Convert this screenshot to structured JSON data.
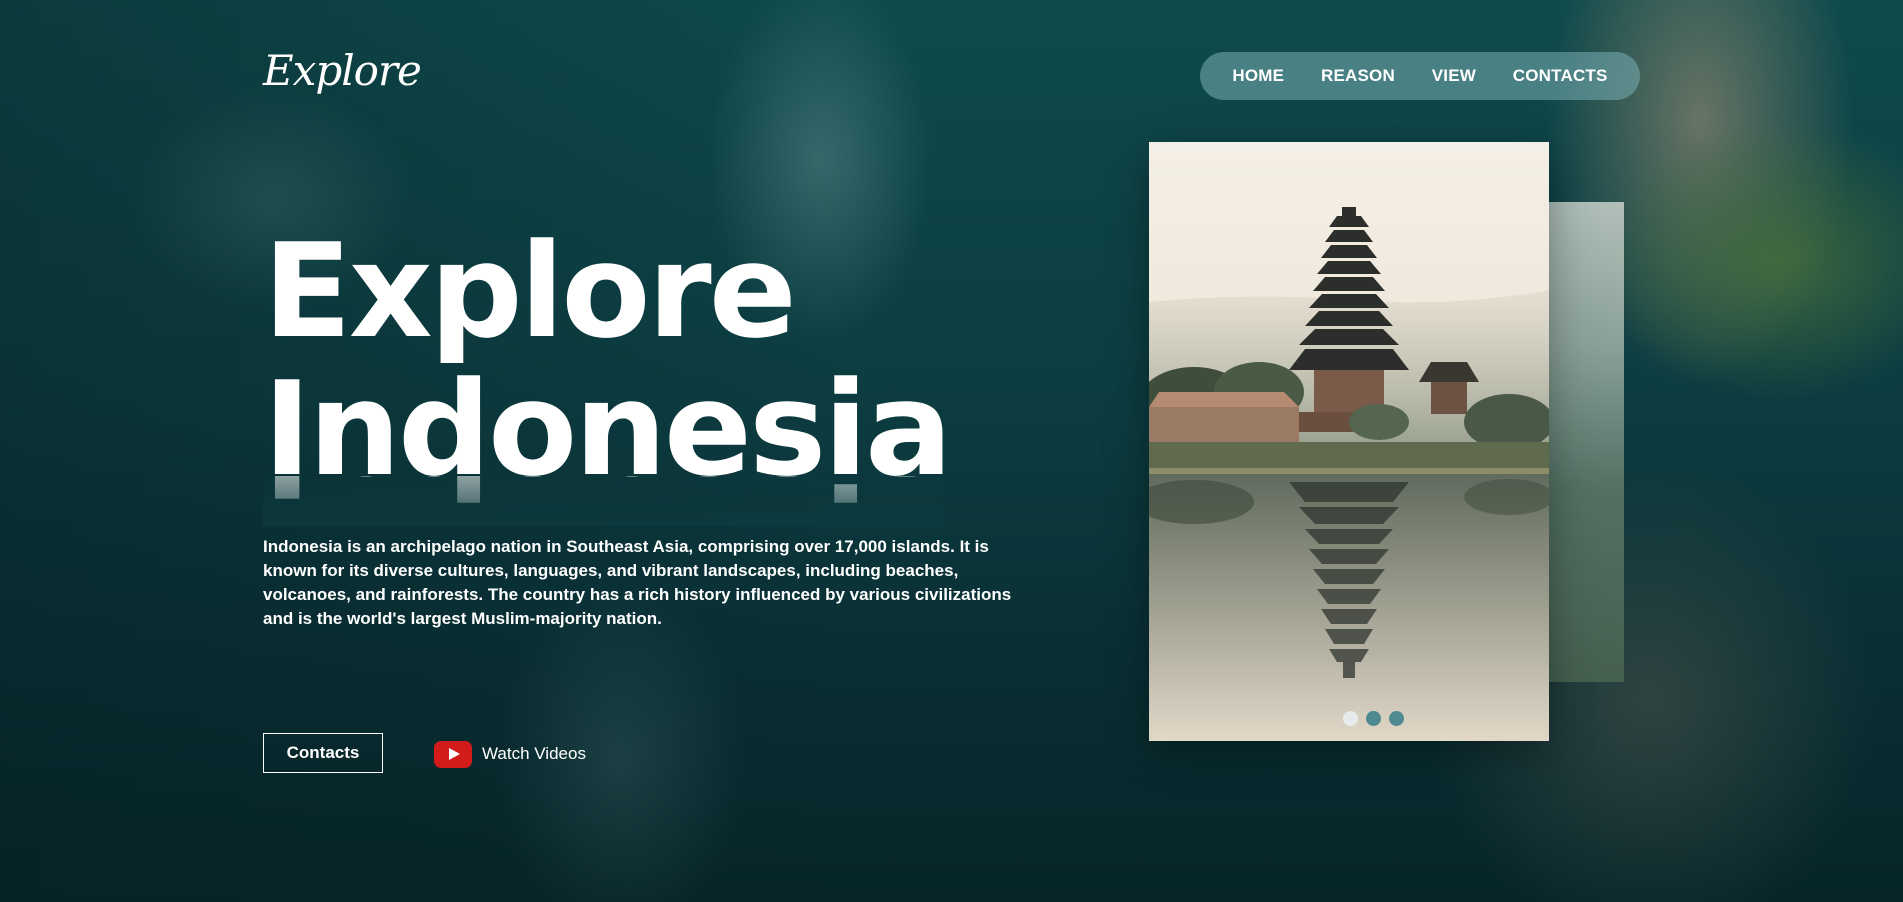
{
  "brand": {
    "logo": "Explore"
  },
  "nav": {
    "items": [
      {
        "label": "HOME"
      },
      {
        "label": "REASON"
      },
      {
        "label": "VIEW"
      },
      {
        "label": "CONTACTS"
      }
    ]
  },
  "hero": {
    "title_line1": "Explore",
    "title_line2": "Indonesia",
    "description": "Indonesia is an archipelago nation in Southeast Asia, comprising over 17,000 islands. It is known for its diverse cultures, languages, and vibrant landscapes, including beaches, volcanoes, and rainforests. The country has a rich history influenced by various civilizations and is the world's largest Muslim-majority nation.",
    "contacts_button": "Contacts",
    "watch_videos": "Watch Videos"
  },
  "slider": {
    "active_index": 0,
    "total": 3
  },
  "colors": {
    "accent_nav": "#78afb4",
    "youtube_red": "#d41b1b",
    "dot_inactive": "#4f8a90",
    "dot_active": "#e6ecec"
  },
  "icons": {
    "play": "youtube-play-icon"
  }
}
